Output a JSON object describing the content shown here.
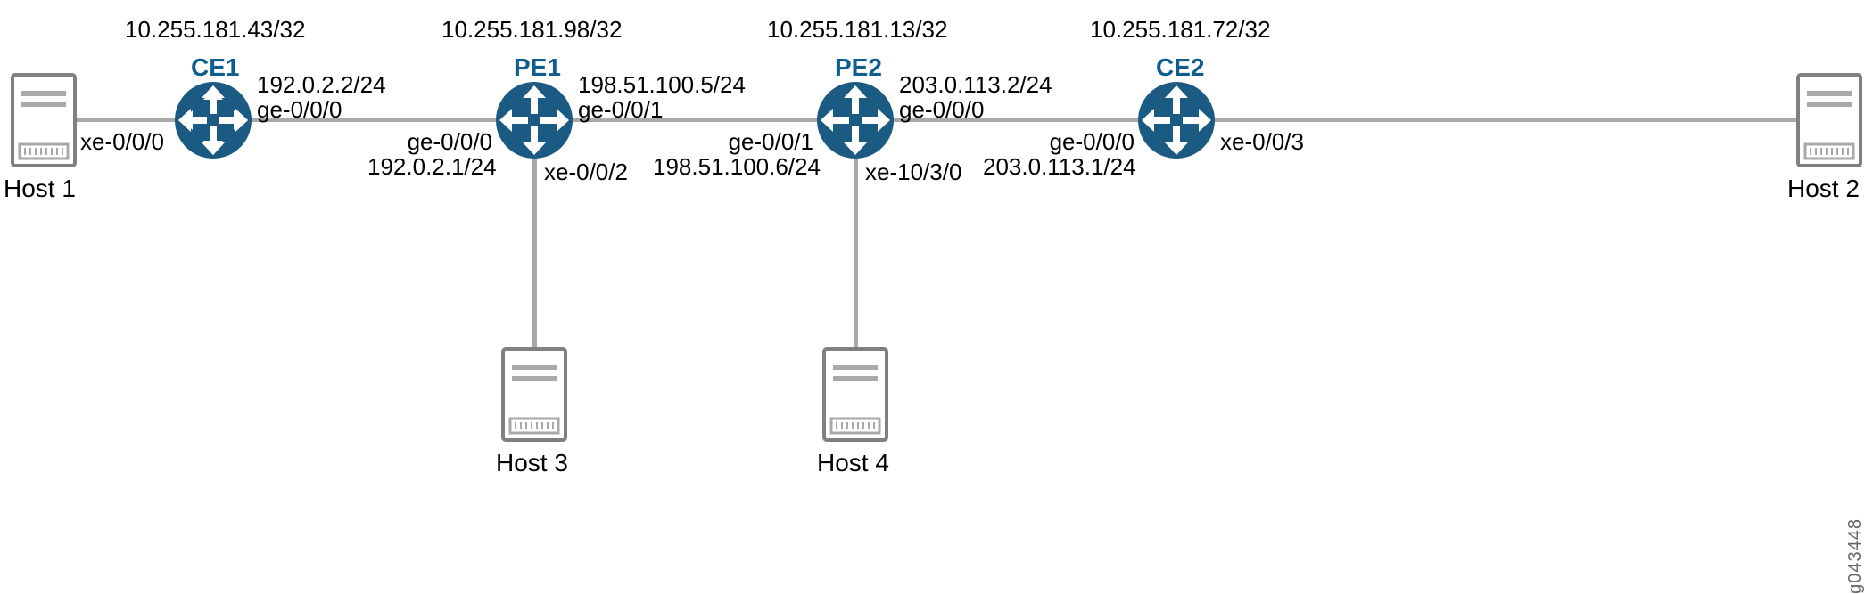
{
  "figure_id": "g043448",
  "colors": {
    "router_fill": "#1b5b83",
    "line": "#a9a9a9",
    "router_text": "#0d5d8f"
  },
  "routers": {
    "ce1": {
      "name": "CE1",
      "loopback": "10.255.181.43/32",
      "right_ip": "192.0.2.2/24",
      "right_if": "ge-0/0/0",
      "left_if_from_host": "xe-0/0/0"
    },
    "pe1": {
      "name": "PE1",
      "loopback": "10.255.181.98/32",
      "right_ip": "198.51.100.5/24",
      "right_if": "ge-0/0/1",
      "left_ip": "192.0.2.1/24",
      "left_if": "ge-0/0/0",
      "down_if": "xe-0/0/2"
    },
    "pe2": {
      "name": "PE2",
      "loopback": "10.255.181.13/32",
      "right_ip": "203.0.113.2/24",
      "right_if": "ge-0/0/0",
      "left_ip": "198.51.100.6/24",
      "left_if": "ge-0/0/1",
      "down_if": "xe-10/3/0"
    },
    "ce2": {
      "name": "CE2",
      "loopback": "10.255.181.72/32",
      "left_ip": "203.0.113.1/24",
      "left_if": "ge-0/0/0",
      "right_if_to_host": "xe-0/0/3"
    }
  },
  "hosts": {
    "h1": {
      "label": "Host 1"
    },
    "h2": {
      "label": "Host 2"
    },
    "h3": {
      "label": "Host 3"
    },
    "h4": {
      "label": "Host 4"
    }
  }
}
